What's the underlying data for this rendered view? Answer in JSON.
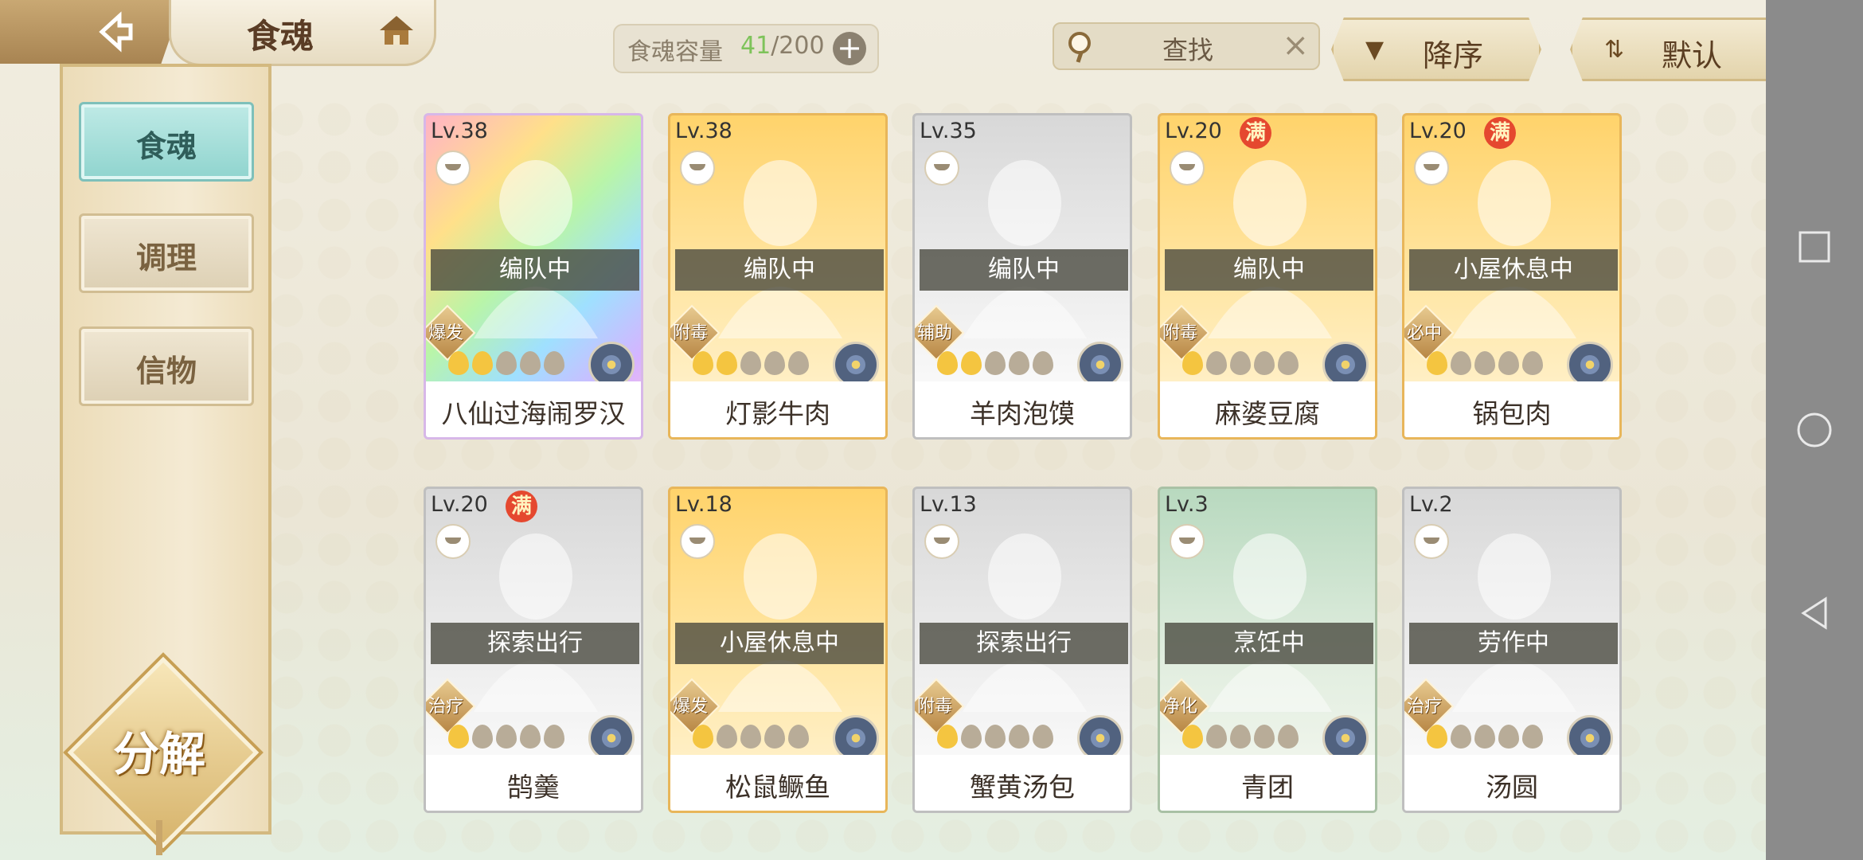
{
  "header": {
    "title": "食魂",
    "capacity_label": "食魂容量",
    "capacity_current": "41",
    "capacity_total": "/200",
    "search_placeholder": "查找",
    "sort_order": "降序",
    "sort_mode": "默认"
  },
  "sidebar": {
    "items": [
      {
        "label": "食魂",
        "active": true
      },
      {
        "label": "调理",
        "active": false
      },
      {
        "label": "信物",
        "active": false
      }
    ],
    "decompose_label": "分解"
  },
  "cards": [
    {
      "level": "Lv.38",
      "status": "编队中",
      "role": "爆发",
      "name": "八仙过海闹罗汉",
      "full": "",
      "stars_on": 2,
      "frame": "rainbow"
    },
    {
      "level": "Lv.38",
      "status": "编队中",
      "role": "附毒",
      "name": "灯影牛肉",
      "full": "",
      "stars_on": 2,
      "frame": "gold"
    },
    {
      "level": "Lv.35",
      "status": "编队中",
      "role": "辅助",
      "name": "羊肉泡馍",
      "full": "",
      "stars_on": 2,
      "frame": "silver"
    },
    {
      "level": "Lv.20",
      "status": "编队中",
      "role": "附毒",
      "name": "麻婆豆腐",
      "full": "满",
      "stars_on": 1,
      "frame": "gold"
    },
    {
      "level": "Lv.20",
      "status": "小屋休息中",
      "role": "必中",
      "name": "锅包肉",
      "full": "满",
      "stars_on": 1,
      "frame": "gold"
    },
    {
      "level": "Lv.20",
      "status": "探索出行",
      "role": "治疗",
      "name": "鹄羹",
      "full": "满",
      "stars_on": 1,
      "frame": "silver"
    },
    {
      "level": "Lv.18",
      "status": "小屋休息中",
      "role": "爆发",
      "name": "松鼠鳜鱼",
      "full": "",
      "stars_on": 1,
      "frame": "gold"
    },
    {
      "level": "Lv.13",
      "status": "探索出行",
      "role": "附毒",
      "name": "蟹黄汤包",
      "full": "",
      "stars_on": 1,
      "frame": "silver"
    },
    {
      "level": "Lv.3",
      "status": "烹饪中",
      "role": "净化",
      "name": "青团",
      "full": "",
      "stars_on": 1,
      "frame": "green"
    },
    {
      "level": "Lv.2",
      "status": "劳作中",
      "role": "治疗",
      "name": "汤圆",
      "full": "",
      "stars_on": 1,
      "frame": "silver"
    }
  ]
}
